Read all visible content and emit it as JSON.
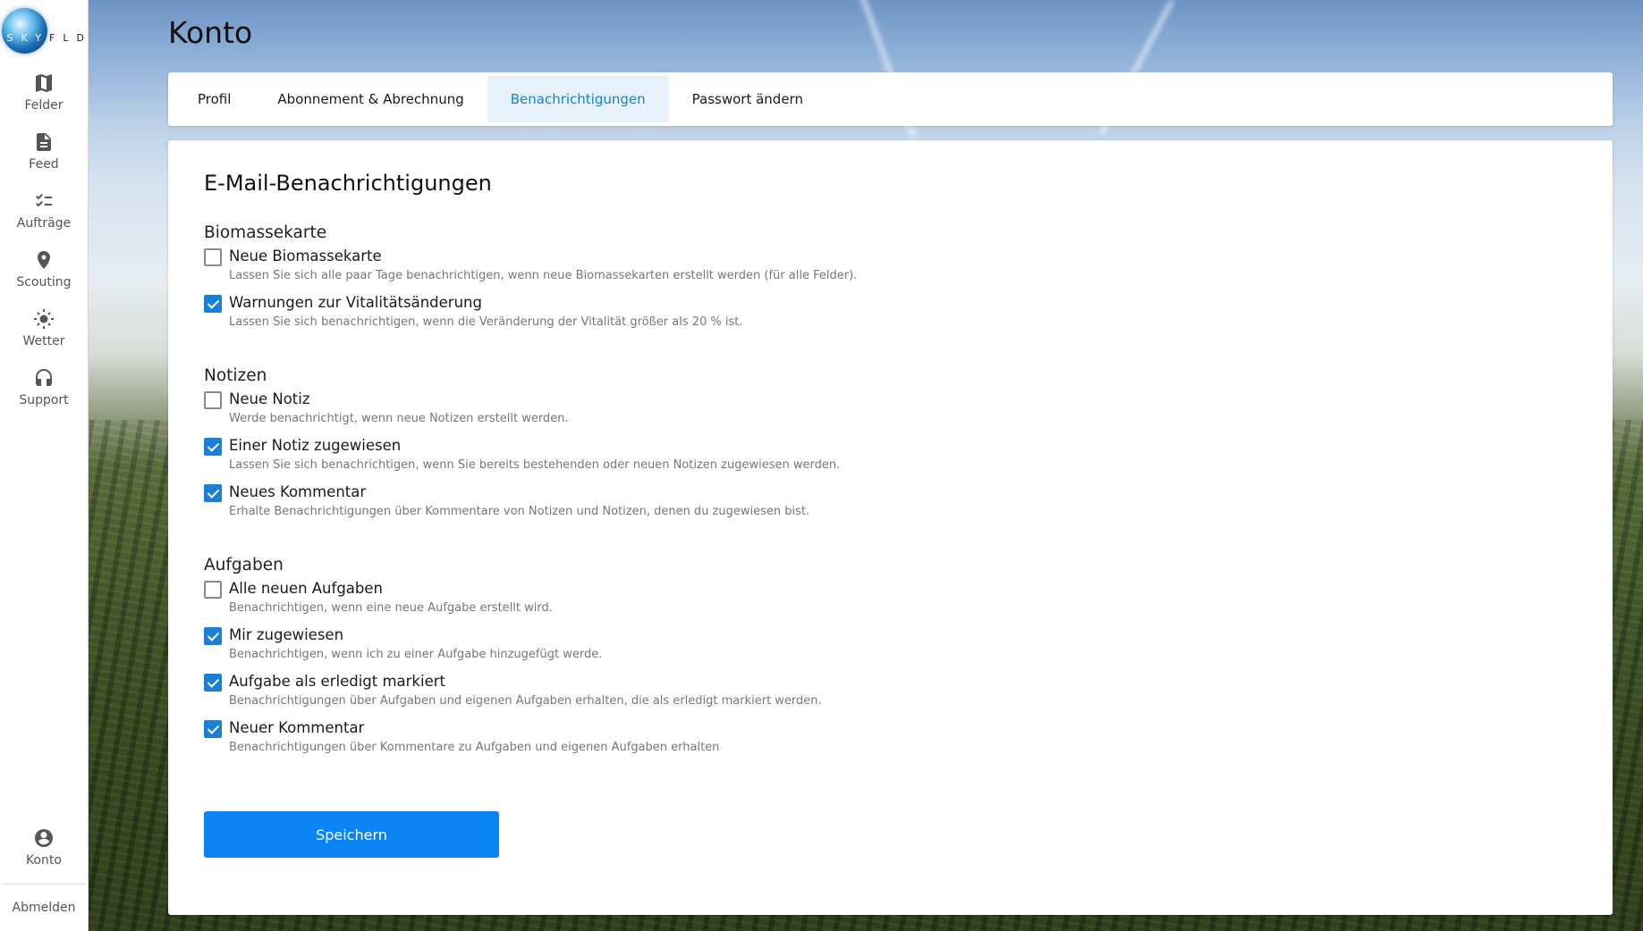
{
  "logo": {
    "text": "SKYFLD"
  },
  "sidebar": {
    "items": [
      {
        "label": "Felder",
        "icon": "map-icon"
      },
      {
        "label": "Feed",
        "icon": "document-icon"
      },
      {
        "label": "Aufträge",
        "icon": "checklist-icon"
      },
      {
        "label": "Scouting",
        "icon": "location-pin-icon"
      },
      {
        "label": "Wetter",
        "icon": "sun-icon"
      },
      {
        "label": "Support",
        "icon": "headset-icon"
      }
    ],
    "account": {
      "label": "Konto",
      "icon": "account-circle-icon"
    },
    "logout": "Abmelden"
  },
  "page": {
    "title": "Konto"
  },
  "tabs": [
    {
      "label": "Profil",
      "active": false
    },
    {
      "label": "Abonnement & Abrechnung",
      "active": false
    },
    {
      "label": "Benachrichtigungen",
      "active": true
    },
    {
      "label": "Passwort ändern",
      "active": false
    }
  ],
  "notifications": {
    "heading": "E-Mail-Benachrichtigungen",
    "sections": [
      {
        "title": "Biomassekarte",
        "options": [
          {
            "label": "Neue Biomassekarte",
            "description": "Lassen Sie sich alle paar Tage benachrichtigen, wenn neue Biomassekarten erstellt werden (für alle Felder).",
            "checked": false
          },
          {
            "label": "Warnungen zur Vitalitätsänderung",
            "description": "Lassen Sie sich benachrichtigen, wenn die Veränderung der Vitalität größer als 20 % ist.",
            "checked": true
          }
        ]
      },
      {
        "title": "Notizen",
        "options": [
          {
            "label": "Neue Notiz",
            "description": "Werde benachrichtigt, wenn neue Notizen erstellt werden.",
            "checked": false
          },
          {
            "label": "Einer Notiz zugewiesen",
            "description": "Lassen Sie sich benachrichtigen, wenn Sie bereits bestehenden oder neuen Notizen zugewiesen werden.",
            "checked": true
          },
          {
            "label": "Neues Kommentar",
            "description": "Erhalte Benachrichtigungen über Kommentare von Notizen und Notizen, denen du zugewiesen bist.",
            "checked": true
          }
        ]
      },
      {
        "title": "Aufgaben",
        "options": [
          {
            "label": "Alle neuen Aufgaben",
            "description": "Benachrichtigen, wenn eine neue Aufgabe erstellt wird.",
            "checked": false
          },
          {
            "label": "Mir zugewiesen",
            "description": "Benachrichtigen, wenn ich zu einer Aufgabe hinzugefügt werde.",
            "checked": true
          },
          {
            "label": "Aufgabe als erledigt markiert",
            "description": "Benachrichtigungen über Aufgaben und eigenen Aufgaben erhalten, die als erledigt markiert werden.",
            "checked": true
          },
          {
            "label": "Neuer Kommentar",
            "description": "Benachrichtigungen über Kommentare zu Aufgaben und eigenen Aufgaben erhalten",
            "checked": true
          }
        ]
      }
    ],
    "save_label": "Speichern"
  },
  "colors": {
    "accent": "#0a84f5",
    "tab_active_bg": "#e6f1fb",
    "tab_active_text": "#1c7fd6"
  }
}
